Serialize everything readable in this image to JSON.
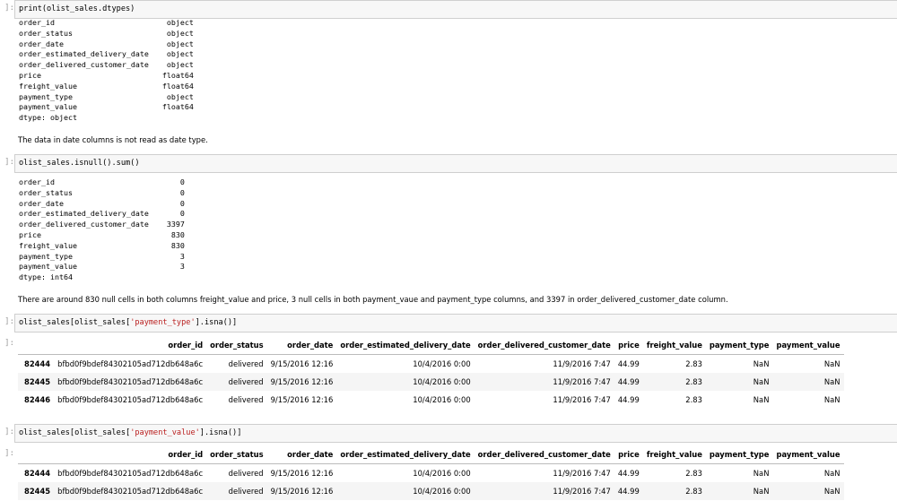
{
  "cells": [
    {
      "prompt": "]:",
      "code": "print(olist_sales.dtypes)"
    },
    {
      "prompt": "]:",
      "code": "olist_sales.isnull().sum()"
    },
    {
      "prompt": "]:",
      "code_pre": "olist_sales[olist_sales[",
      "code_str": "'payment_type'",
      "code_post": "].isna()]"
    },
    {
      "prompt": "]:",
      "code_pre": "olist_sales[olist_sales[",
      "code_str": "'payment_value'",
      "code_post": "].isna()]"
    }
  ],
  "outputs": {
    "dtypes": "order_id                         object\norder_status                     object\norder_date                       object\norder_estimated_delivery_date    object\norder_delivered_customer_date    object\nprice                           float64\nfreight_value                   float64\npayment_type                     object\npayment_value                   float64\ndtype: object",
    "nulls": "order_id                            0\norder_status                        0\norder_date                          0\norder_estimated_delivery_date       0\norder_delivered_customer_date    3397\nprice                             830\nfreight_value                     830\npayment_type                        3\npayment_value                       3\ndtype: int64",
    "out_prompt_3": "]:",
    "out_prompt_4": "]:"
  },
  "markdown": [
    "The data in date columns is not read as date type.",
    "There are around 830 null cells in both columns freight_value and price, 3 null cells in both payment_vaue and payment_type columns, and 3397 in order_delivered_customer_date column."
  ],
  "table_columns": [
    "",
    "order_id",
    "order_status",
    "order_date",
    "order_estimated_delivery_date",
    "order_delivered_customer_date",
    "price",
    "freight_value",
    "payment_type",
    "payment_value"
  ],
  "table1_rows": [
    [
      "82444",
      "bfbd0f9bdef84302105ad712db648a6c",
      "delivered",
      "9/15/2016 12:16",
      "10/4/2016 0:00",
      "11/9/2016 7:47",
      "44.99",
      "2.83",
      "NaN",
      "NaN"
    ],
    [
      "82445",
      "bfbd0f9bdef84302105ad712db648a6c",
      "delivered",
      "9/15/2016 12:16",
      "10/4/2016 0:00",
      "11/9/2016 7:47",
      "44.99",
      "2.83",
      "NaN",
      "NaN"
    ],
    [
      "82446",
      "bfbd0f9bdef84302105ad712db648a6c",
      "delivered",
      "9/15/2016 12:16",
      "10/4/2016 0:00",
      "11/9/2016 7:47",
      "44.99",
      "2.83",
      "NaN",
      "NaN"
    ]
  ],
  "table2_rows": [
    [
      "82444",
      "bfbd0f9bdef84302105ad712db648a6c",
      "delivered",
      "9/15/2016 12:16",
      "10/4/2016 0:00",
      "11/9/2016 7:47",
      "44.99",
      "2.83",
      "NaN",
      "NaN"
    ],
    [
      "82445",
      "bfbd0f9bdef84302105ad712db648a6c",
      "delivered",
      "9/15/2016 12:16",
      "10/4/2016 0:00",
      "11/9/2016 7:47",
      "44.99",
      "2.83",
      "NaN",
      "NaN"
    ]
  ]
}
